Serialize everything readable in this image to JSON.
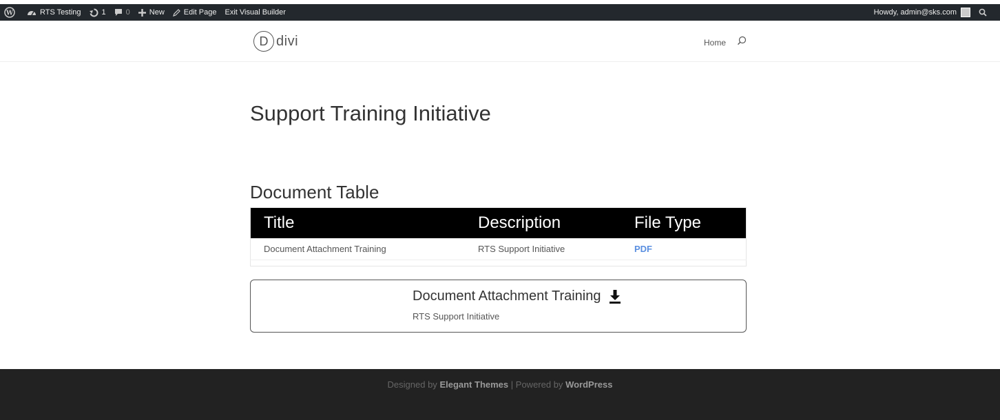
{
  "admin_bar": {
    "site_name": "RTS Testing",
    "updates_count": "1",
    "comments_count": "0",
    "new_label": "New",
    "edit_page_label": "Edit Page",
    "exit_builder_label": "Exit Visual Builder",
    "howdy_label": "Howdy, admin@sks.com"
  },
  "header": {
    "logo_letter": "D",
    "logo_text": "divi",
    "nav": {
      "home_label": "Home"
    }
  },
  "page": {
    "title": "Support Training Initiative",
    "section_title": "Document Table"
  },
  "table": {
    "headers": [
      "Title",
      "Description",
      "File Type"
    ],
    "rows": [
      {
        "title": "Document Attachment Training",
        "description": "RTS Support Initiative",
        "file_type": "PDF"
      }
    ]
  },
  "card": {
    "title": "Document Attachment Training",
    "description": "RTS Support Initiative"
  },
  "footer": {
    "designed_by": "Designed by",
    "theme_name": "Elegant Themes",
    "separator": "|",
    "powered_by": "Powered by",
    "platform": "WordPress"
  },
  "colors": {
    "admin_bar_bg": "#23282d",
    "table_header_bg": "#000000",
    "link_blue": "#5a8fe0",
    "footer_bg": "#222222"
  }
}
